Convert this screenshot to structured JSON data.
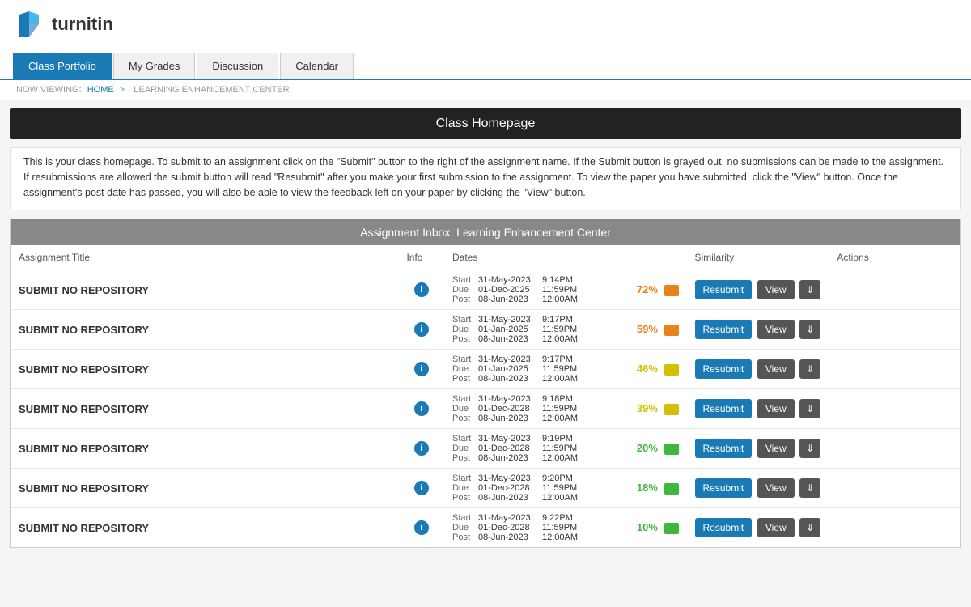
{
  "header": {
    "logo_text": "turnitin",
    "logo_alt": "Turnitin logo"
  },
  "nav": {
    "tabs": [
      {
        "label": "Class Portfolio",
        "active": true
      },
      {
        "label": "My Grades",
        "active": false
      },
      {
        "label": "Discussion",
        "active": false
      },
      {
        "label": "Calendar",
        "active": false
      }
    ]
  },
  "breadcrumb": {
    "prefix": "NOW VIEWING:",
    "home": "HOME",
    "separator": ">",
    "current": "LEARNING ENHANCEMENT CENTER"
  },
  "page_title": "Class Homepage",
  "description": "This is your class homepage. To submit to an assignment click on the \"Submit\" button to the right of the assignment name. If the Submit button is grayed out, no submissions can be made to the assignment. If resubmissions are allowed the submit button will read \"Resubmit\" after you make your first submission to the assignment. To view the paper you have submitted, click the \"View\" button. Once the assignment's post date has passed, you will also be able to view the feedback left on your paper by clicking the \"View\" button.",
  "inbox": {
    "title": "Assignment Inbox: Learning Enhancement Center",
    "columns": [
      "Assignment Title",
      "Info",
      "Dates",
      "",
      "",
      "Similarity",
      "Actions"
    ],
    "col_labels": {
      "title": "Assignment Title",
      "info": "Info",
      "dates": "Dates",
      "similarity": "Similarity",
      "actions": "Actions"
    },
    "rows": [
      {
        "title": "SUBMIT NO REPOSITORY",
        "start_date": "31-May-2023",
        "start_time": "9:14PM",
        "due_date": "01-Dec-2025",
        "due_time": "11:59PM",
        "post_date": "08-Jun-2023",
        "post_time": "12:00AM",
        "similarity": "72%",
        "sim_color": "#e8821a",
        "resubmit_label": "Resubmit",
        "view_label": "View"
      },
      {
        "title": "SUBMIT NO REPOSITORY",
        "start_date": "31-May-2023",
        "start_time": "9:17PM",
        "due_date": "01-Jan-2025",
        "due_time": "11:59PM",
        "post_date": "08-Jun-2023",
        "post_time": "12:00AM",
        "similarity": "59%",
        "sim_color": "#e8821a",
        "resubmit_label": "Resubmit",
        "view_label": "View"
      },
      {
        "title": "SUBMIT NO REPOSITORY",
        "start_date": "31-May-2023",
        "start_time": "9:17PM",
        "due_date": "01-Jan-2025",
        "due_time": "11:59PM",
        "post_date": "08-Jun-2023",
        "post_time": "12:00AM",
        "similarity": "46%",
        "sim_color": "#d4c000",
        "resubmit_label": "Resubmit",
        "view_label": "View"
      },
      {
        "title": "SUBMIT NO REPOSITORY",
        "start_date": "31-May-2023",
        "start_time": "9:18PM",
        "due_date": "01-Dec-2028",
        "due_time": "11:59PM",
        "post_date": "08-Jun-2023",
        "post_time": "12:00AM",
        "similarity": "39%",
        "sim_color": "#d4c000",
        "resubmit_label": "Resubmit",
        "view_label": "View"
      },
      {
        "title": "SUBMIT NO REPOSITORY",
        "start_date": "31-May-2023",
        "start_time": "9:19PM",
        "due_date": "01-Dec-2028",
        "due_time": "11:59PM",
        "post_date": "08-Jun-2023",
        "post_time": "12:00AM",
        "similarity": "20%",
        "sim_color": "#3db83d",
        "resubmit_label": "Resubmit",
        "view_label": "View"
      },
      {
        "title": "SUBMIT NO REPOSITORY",
        "start_date": "31-May-2023",
        "start_time": "9:20PM",
        "due_date": "01-Dec-2028",
        "due_time": "11:59PM",
        "post_date": "08-Jun-2023",
        "post_time": "12:00AM",
        "similarity": "18%",
        "sim_color": "#3db83d",
        "resubmit_label": "Resubmit",
        "view_label": "View"
      },
      {
        "title": "SUBMIT NO REPOSITORY",
        "start_date": "31-May-2023",
        "start_time": "9:22PM",
        "due_date": "01-Dec-2028",
        "due_time": "11:59PM",
        "post_date": "08-Jun-2023",
        "post_time": "12:00AM",
        "similarity": "10%",
        "sim_color": "#3db83d",
        "resubmit_label": "Resubmit",
        "view_label": "View"
      }
    ]
  }
}
